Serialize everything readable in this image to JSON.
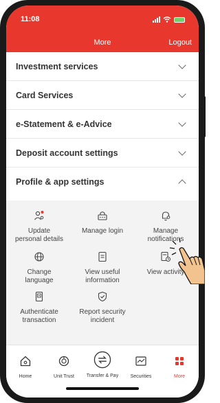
{
  "status_bar": {
    "time": "11:08"
  },
  "header": {
    "title": "More",
    "logout_label": "Logout"
  },
  "menu": {
    "items": [
      {
        "label": "Investment services",
        "expanded": false
      },
      {
        "label": "Card Services",
        "expanded": false
      },
      {
        "label": "e-Statement & e-Advice",
        "expanded": false
      },
      {
        "label": "Deposit account settings",
        "expanded": false
      },
      {
        "label": "Profile & app settings",
        "expanded": true
      }
    ]
  },
  "profile_settings": {
    "tiles": [
      {
        "line1": "Update",
        "line2": "personal details",
        "icon": "user-settings-icon"
      },
      {
        "line1": "Manage login",
        "line2": "",
        "icon": "login-lock-icon"
      },
      {
        "line1": "Manage",
        "line2": "notifications",
        "icon": "notification-settings-icon"
      },
      {
        "line1": "Change",
        "line2": "language",
        "icon": "globe-icon"
      },
      {
        "line1": "View useful",
        "line2": "information",
        "icon": "document-info-icon"
      },
      {
        "line1": "View activity",
        "line2": "",
        "icon": "activity-clock-icon"
      },
      {
        "line1": "Authenticate",
        "line2": "transaction",
        "icon": "security-device-icon"
      },
      {
        "line1": "Report security",
        "line2": "incident",
        "icon": "shield-check-icon"
      }
    ]
  },
  "bottom_nav": {
    "items": [
      {
        "label": "Home",
        "icon": "home-icon"
      },
      {
        "label": "Unit Trust",
        "icon": "unit-trust-icon"
      },
      {
        "label": "Transfer & Pay",
        "icon": "transfer-icon"
      },
      {
        "label": "Securities",
        "icon": "chart-icon"
      },
      {
        "label": "More",
        "icon": "more-icon",
        "active": true
      }
    ]
  },
  "colors": {
    "brand": "#e8372c",
    "panel": "#f3f3f3",
    "text": "#333333"
  }
}
